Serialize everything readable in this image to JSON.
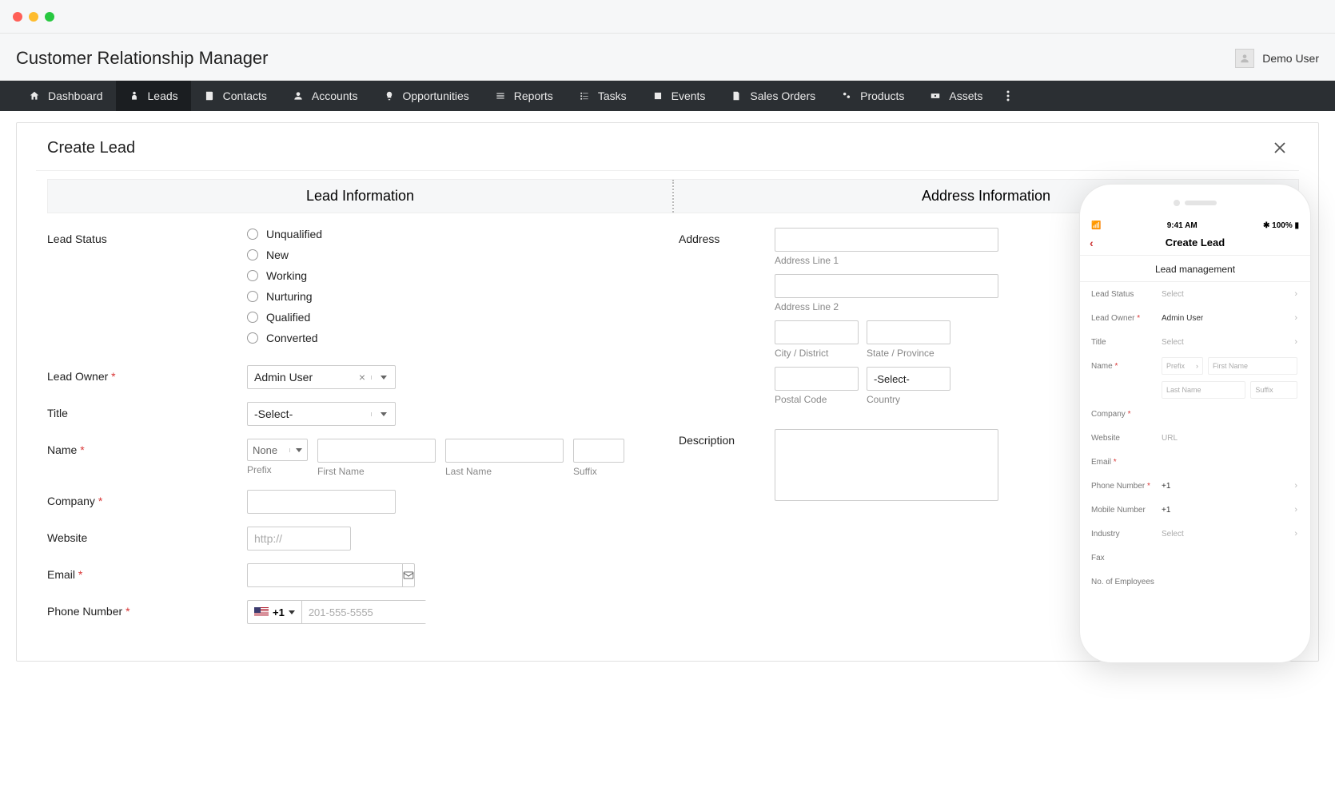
{
  "app_title": "Customer Relationship Manager",
  "user_name": "Demo User",
  "nav": [
    {
      "label": "Dashboard",
      "icon": "home-icon"
    },
    {
      "label": "Leads",
      "icon": "person-icon",
      "active": true
    },
    {
      "label": "Contacts",
      "icon": "book-icon"
    },
    {
      "label": "Accounts",
      "icon": "user-icon"
    },
    {
      "label": "Opportunities",
      "icon": "bulb-icon"
    },
    {
      "label": "Reports",
      "icon": "list-icon"
    },
    {
      "label": "Tasks",
      "icon": "checklist-icon"
    },
    {
      "label": "Events",
      "icon": "calendar-icon"
    },
    {
      "label": "Sales Orders",
      "icon": "doc-icon"
    },
    {
      "label": "Products",
      "icon": "gear-cluster-icon"
    },
    {
      "label": "Assets",
      "icon": "money-icon"
    }
  ],
  "page_title": "Create Lead",
  "sections": {
    "lead_info": "Lead Information",
    "address_info": "Address Information"
  },
  "fields": {
    "lead_status_label": "Lead Status",
    "lead_status_options": [
      "Unqualified",
      "New",
      "Working",
      "Nurturing",
      "Qualified",
      "Converted"
    ],
    "lead_owner_label": "Lead Owner",
    "lead_owner_value": "Admin User",
    "title_label": "Title",
    "title_value": "-Select-",
    "name_label": "Name",
    "prefix_value": "None",
    "prefix_caption": "Prefix",
    "first_name_caption": "First Name",
    "last_name_caption": "Last Name",
    "suffix_caption": "Suffix",
    "company_label": "Company",
    "website_label": "Website",
    "website_placeholder": "http://",
    "email_label": "Email",
    "phone_label": "Phone Number",
    "phone_cc": "+1",
    "phone_placeholder": "201-555-5555",
    "address_label": "Address",
    "addr_line1_caption": "Address Line 1",
    "addr_line2_caption": "Address Line 2",
    "city_caption": "City / District",
    "state_caption": "State / Province",
    "postal_caption": "Postal Code",
    "country_caption": "Country",
    "country_value": "-Select-",
    "description_label": "Description"
  },
  "mobile": {
    "time": "9:41 AM",
    "battery": "100%",
    "title": "Create Lead",
    "subtitle": "Lead management",
    "rows": [
      {
        "label": "Lead Status",
        "value": "Select",
        "chev": true
      },
      {
        "label": "Lead Owner",
        "req": true,
        "value": "Admin User",
        "chev": true
      },
      {
        "label": "Title",
        "value": "Select",
        "chev": true
      },
      {
        "label": "Name",
        "req": true,
        "prefix": "Prefix",
        "first": "First Name"
      },
      {
        "indent": true,
        "last": "Last Name",
        "suffix": "Suffix"
      },
      {
        "label": "Company",
        "req": true,
        "value": ""
      },
      {
        "label": "Website",
        "value": "URL"
      },
      {
        "label": "Email",
        "req": true,
        "value": ""
      },
      {
        "label": "Phone Number",
        "req": true,
        "value": "+1",
        "chev": true
      },
      {
        "label": "Mobile Number",
        "value": "+1",
        "chev": true
      },
      {
        "label": "Industry",
        "value": "Select",
        "chev": true
      },
      {
        "label": "Fax",
        "value": ""
      },
      {
        "label": "No. of Employees",
        "value": ""
      }
    ]
  }
}
